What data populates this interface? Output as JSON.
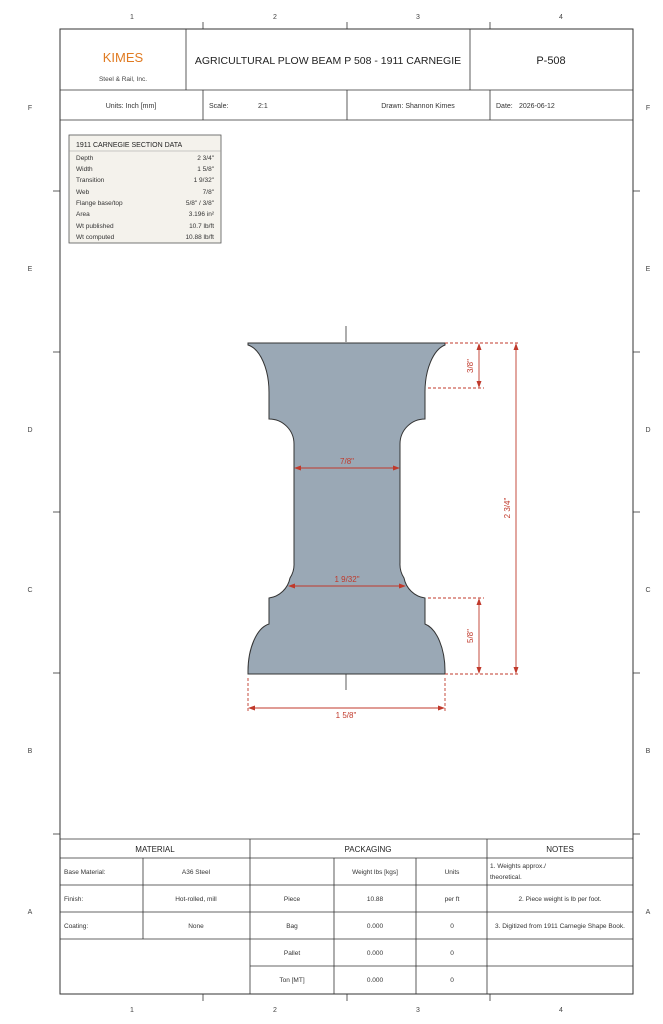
{
  "sheet": {
    "col_labels": [
      "1",
      "2",
      "3",
      "4"
    ],
    "row_labels": [
      "F",
      "E",
      "D",
      "C",
      "B",
      "A"
    ]
  },
  "title_block": {
    "company": "KIMES",
    "company_sub": "Steel & Rail, Inc.",
    "title": "AGRICULTURAL PLOW BEAM P 508 - 1911 CARNEGIE",
    "part_no": "P-508",
    "units": "Units: Inch [mm]",
    "scale_label": "Scale:",
    "scale_value": "2:1",
    "drawn": "Drawn: Shannon Kimes",
    "date_label": "Date:",
    "date_value": "2026-06-12"
  },
  "section_data": {
    "title": "1911 CARNEGIE SECTION DATA",
    "rows": [
      {
        "label": "Depth",
        "value": "2 3/4\""
      },
      {
        "label": "Width",
        "value": "1 5/8\""
      },
      {
        "label": "Transition",
        "value": "1 9/32\""
      },
      {
        "label": "Web",
        "value": "7/8\""
      },
      {
        "label": "Flange base/top",
        "value": "5/8\" / 3/8\""
      },
      {
        "label": "Area",
        "value": "3.196 in²"
      },
      {
        "label": "Wt published",
        "value": "10.7 lb/ft"
      },
      {
        "label": "Wt computed",
        "value": "10.88 lb/ft"
      }
    ]
  },
  "dimensions": {
    "top_flange": "3/8\"",
    "depth": "2 3/4\"",
    "web": "7/8\"",
    "transition": "1 9/32\"",
    "bottom_flange": "5/8\"",
    "width": "1 5/8\""
  },
  "material": {
    "header": "MATERIAL",
    "rows": [
      {
        "label": "Base Material:",
        "value": "A36 Steel"
      },
      {
        "label": "Finish:",
        "value": "Hot-rolled, mill"
      },
      {
        "label": "Coating:",
        "value": "None"
      }
    ]
  },
  "packaging": {
    "header": "PACKAGING",
    "col_weight": "Weight lbs [kgs]",
    "col_units": "Units",
    "rows": [
      {
        "label": "Piece",
        "weight": "10.88",
        "units": "per ft"
      },
      {
        "label": "Bag",
        "weight": "0.000",
        "units": "0"
      },
      {
        "label": "Pallet",
        "weight": "0.000",
        "units": "0"
      },
      {
        "label": "Ton [MT]",
        "weight": "0.000",
        "units": "0"
      }
    ]
  },
  "notes": {
    "header": "NOTES",
    "note1_line1": "1. Weights approx./",
    "note1_line2": "theoretical.",
    "note2": "2. Piece weight is lb per foot.",
    "note3": "3. Digitized from 1911 Carnegie Shape Book."
  },
  "colors": {
    "accent": "#e07b22",
    "section_fill": "#9aa8b5",
    "dimension": "#c0392b",
    "frame": "#333333",
    "data_box_bg": "#f4f2ec"
  }
}
